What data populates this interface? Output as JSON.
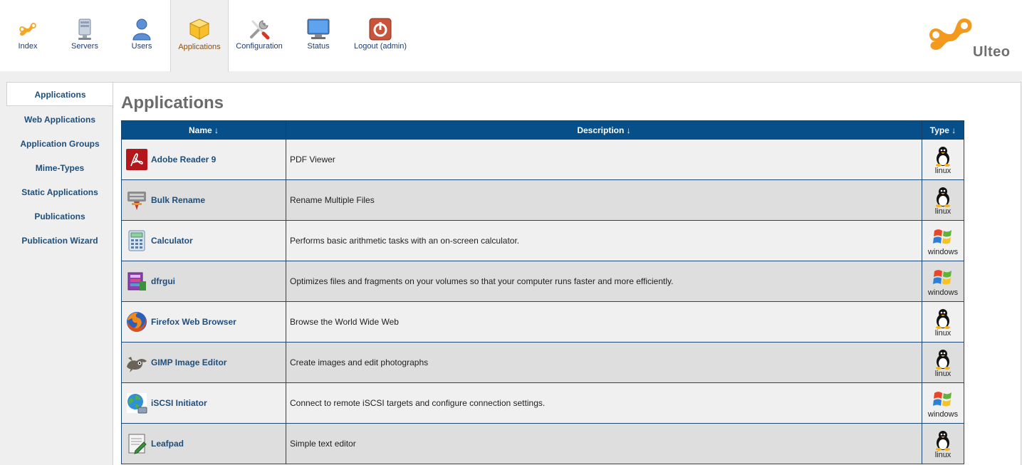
{
  "nav": {
    "items": [
      {
        "label": "Index",
        "icon": "ulteo-index-icon"
      },
      {
        "label": "Servers",
        "icon": "server-icon"
      },
      {
        "label": "Users",
        "icon": "user-icon"
      },
      {
        "label": "Applications",
        "icon": "applications-box-icon",
        "active": true
      },
      {
        "label": "Configuration",
        "icon": "tools-icon"
      },
      {
        "label": "Status",
        "icon": "monitor-icon"
      },
      {
        "label": "Logout (admin)",
        "icon": "power-icon"
      }
    ]
  },
  "brand": {
    "name": "Ulteo",
    "color": "#f39a1e"
  },
  "sidebar": {
    "items": [
      {
        "label": "Applications",
        "active": true
      },
      {
        "label": "Web Applications"
      },
      {
        "label": "Application Groups"
      },
      {
        "label": "Mime-Types"
      },
      {
        "label": "Static Applications"
      },
      {
        "label": "Publications"
      },
      {
        "label": "Publication Wizard"
      }
    ]
  },
  "main": {
    "title": "Applications",
    "table": {
      "headers": {
        "name": "Name ↓",
        "description": "Description ↓",
        "type": "Type ↓"
      },
      "rows": [
        {
          "name": "Adobe Reader 9",
          "description": "PDF Viewer",
          "type": "linux",
          "icon": "adobe-reader-icon"
        },
        {
          "name": "Bulk Rename",
          "description": "Rename Multiple Files",
          "type": "linux",
          "icon": "bulk-rename-icon"
        },
        {
          "name": "Calculator",
          "description": "Performs basic arithmetic tasks with an on-screen calculator.",
          "type": "windows",
          "icon": "calculator-icon"
        },
        {
          "name": "dfrgui",
          "description": "Optimizes files and fragments on your volumes so that your computer runs faster and more efficiently.",
          "type": "windows",
          "icon": "defrag-icon"
        },
        {
          "name": "Firefox Web Browser",
          "description": "Browse the World Wide Web",
          "type": "linux",
          "icon": "firefox-icon"
        },
        {
          "name": "GIMP Image Editor",
          "description": "Create images and edit photographs",
          "type": "linux",
          "icon": "gimp-icon"
        },
        {
          "name": "iSCSI Initiator",
          "description": "Connect to remote iSCSI targets and configure connection settings.",
          "type": "windows",
          "icon": "iscsi-globe-icon"
        },
        {
          "name": "Leafpad",
          "description": "Simple text editor",
          "type": "linux",
          "icon": "leafpad-icon"
        }
      ]
    }
  }
}
